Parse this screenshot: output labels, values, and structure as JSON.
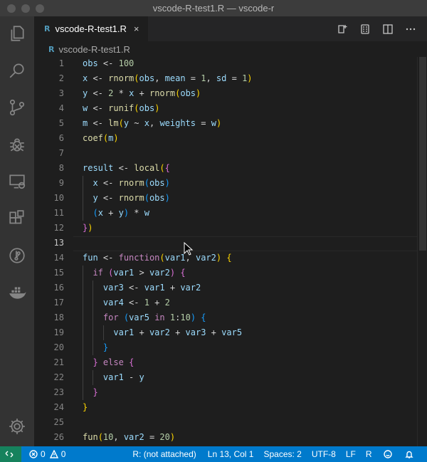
{
  "window": {
    "title": "vscode-R-test1.R — vscode-r"
  },
  "tab": {
    "label": "vscode-R-test1.R",
    "close": "×",
    "file_icon": "R"
  },
  "breadcrumb": {
    "label": "vscode-R-test1.R",
    "file_icon": "R"
  },
  "activity_bar": [
    "explorer-icon",
    "search-icon",
    "source-control-icon",
    "debug-icon",
    "remote-explorer-icon",
    "extensions-icon",
    "git-graph-icon",
    "docker-icon",
    "settings-gear-icon"
  ],
  "editor_actions": [
    "run-source-icon",
    "preview-icon",
    "split-editor-icon",
    "more-actions-icon"
  ],
  "editor": {
    "current_line": 13,
    "lines": [
      {
        "n": "1",
        "tokens": [
          [
            "obs",
            "v"
          ],
          [
            " <- ",
            "o"
          ],
          [
            "100",
            "n"
          ]
        ]
      },
      {
        "n": "2",
        "tokens": [
          [
            "x",
            "v"
          ],
          [
            " <- ",
            "o"
          ],
          [
            "rnorm",
            "f"
          ],
          [
            "(",
            "b1"
          ],
          [
            "obs",
            "v"
          ],
          [
            ", ",
            "o"
          ],
          [
            "mean",
            "v"
          ],
          [
            " = ",
            "o"
          ],
          [
            "1",
            "n"
          ],
          [
            ", ",
            "o"
          ],
          [
            "sd",
            "v"
          ],
          [
            " = ",
            "o"
          ],
          [
            "1",
            "n"
          ],
          [
            ")",
            "b1"
          ]
        ]
      },
      {
        "n": "3",
        "tokens": [
          [
            "y",
            "v"
          ],
          [
            " <- ",
            "o"
          ],
          [
            "2",
            "n"
          ],
          [
            " * ",
            "o"
          ],
          [
            "x",
            "v"
          ],
          [
            " + ",
            "o"
          ],
          [
            "rnorm",
            "f"
          ],
          [
            "(",
            "b1"
          ],
          [
            "obs",
            "v"
          ],
          [
            ")",
            "b1"
          ]
        ]
      },
      {
        "n": "4",
        "tokens": [
          [
            "w",
            "v"
          ],
          [
            " <- ",
            "o"
          ],
          [
            "runif",
            "f"
          ],
          [
            "(",
            "b1"
          ],
          [
            "obs",
            "v"
          ],
          [
            ")",
            "b1"
          ]
        ]
      },
      {
        "n": "5",
        "tokens": [
          [
            "m",
            "v"
          ],
          [
            " <- ",
            "o"
          ],
          [
            "lm",
            "f"
          ],
          [
            "(",
            "b1"
          ],
          [
            "y",
            "v"
          ],
          [
            " ~ ",
            "o"
          ],
          [
            "x",
            "v"
          ],
          [
            ", ",
            "o"
          ],
          [
            "weights",
            "v"
          ],
          [
            " = ",
            "o"
          ],
          [
            "w",
            "v"
          ],
          [
            ")",
            "b1"
          ]
        ]
      },
      {
        "n": "6",
        "tokens": [
          [
            "coef",
            "f"
          ],
          [
            "(",
            "b1"
          ],
          [
            "m",
            "v"
          ],
          [
            ")",
            "b1"
          ]
        ]
      },
      {
        "n": "7",
        "tokens": []
      },
      {
        "n": "8",
        "tokens": [
          [
            "result",
            "v"
          ],
          [
            " <- ",
            "o"
          ],
          [
            "local",
            "f"
          ],
          [
            "(",
            "b1"
          ],
          [
            "{",
            "b2"
          ]
        ]
      },
      {
        "n": "9",
        "tokens": [
          [
            "  ",
            "o"
          ],
          [
            "x",
            "v"
          ],
          [
            " <- ",
            "o"
          ],
          [
            "rnorm",
            "f"
          ],
          [
            "(",
            "b3"
          ],
          [
            "obs",
            "v"
          ],
          [
            ")",
            "b3"
          ]
        ]
      },
      {
        "n": "10",
        "tokens": [
          [
            "  ",
            "o"
          ],
          [
            "y",
            "v"
          ],
          [
            " <- ",
            "o"
          ],
          [
            "rnorm",
            "f"
          ],
          [
            "(",
            "b3"
          ],
          [
            "obs",
            "v"
          ],
          [
            ")",
            "b3"
          ]
        ]
      },
      {
        "n": "11",
        "tokens": [
          [
            "  ",
            "o"
          ],
          [
            "(",
            "b3"
          ],
          [
            "x",
            "v"
          ],
          [
            " + ",
            "o"
          ],
          [
            "y",
            "v"
          ],
          [
            ")",
            "b3"
          ],
          [
            " * ",
            "o"
          ],
          [
            "w",
            "v"
          ]
        ]
      },
      {
        "n": "12",
        "tokens": [
          [
            "}",
            "b2"
          ],
          [
            ")",
            "b1"
          ]
        ]
      },
      {
        "n": "13",
        "tokens": []
      },
      {
        "n": "14",
        "tokens": [
          [
            "fun",
            "v"
          ],
          [
            " <- ",
            "o"
          ],
          [
            "function",
            "k"
          ],
          [
            "(",
            "b1"
          ],
          [
            "var1",
            "v"
          ],
          [
            ", ",
            "o"
          ],
          [
            "var2",
            "v"
          ],
          [
            ")",
            "b1"
          ],
          [
            " ",
            "o"
          ],
          [
            "{",
            "b1"
          ]
        ]
      },
      {
        "n": "15",
        "tokens": [
          [
            "  ",
            "o"
          ],
          [
            "if",
            "k"
          ],
          [
            " ",
            "o"
          ],
          [
            "(",
            "b2"
          ],
          [
            "var1",
            "v"
          ],
          [
            " > ",
            "o"
          ],
          [
            "var2",
            "v"
          ],
          [
            ")",
            "b2"
          ],
          [
            " ",
            "o"
          ],
          [
            "{",
            "b2"
          ]
        ]
      },
      {
        "n": "16",
        "tokens": [
          [
            "    ",
            "o"
          ],
          [
            "var3",
            "v"
          ],
          [
            " <- ",
            "o"
          ],
          [
            "var1",
            "v"
          ],
          [
            " + ",
            "o"
          ],
          [
            "var2",
            "v"
          ]
        ]
      },
      {
        "n": "17",
        "tokens": [
          [
            "    ",
            "o"
          ],
          [
            "var4",
            "v"
          ],
          [
            " <- ",
            "o"
          ],
          [
            "1",
            "n"
          ],
          [
            " + ",
            "o"
          ],
          [
            "2",
            "n"
          ]
        ]
      },
      {
        "n": "18",
        "tokens": [
          [
            "    ",
            "o"
          ],
          [
            "for",
            "k"
          ],
          [
            " ",
            "o"
          ],
          [
            "(",
            "b3"
          ],
          [
            "var5",
            "v"
          ],
          [
            " ",
            "o"
          ],
          [
            "in",
            "k"
          ],
          [
            " ",
            "o"
          ],
          [
            "1",
            "n"
          ],
          [
            ":",
            "o"
          ],
          [
            "10",
            "n"
          ],
          [
            ")",
            "b3"
          ],
          [
            " ",
            "o"
          ],
          [
            "{",
            "b3"
          ]
        ]
      },
      {
        "n": "19",
        "tokens": [
          [
            "      ",
            "o"
          ],
          [
            "var1",
            "v"
          ],
          [
            " + ",
            "o"
          ],
          [
            "var2",
            "v"
          ],
          [
            " + ",
            "o"
          ],
          [
            "var3",
            "v"
          ],
          [
            " + ",
            "o"
          ],
          [
            "var5",
            "v"
          ]
        ]
      },
      {
        "n": "20",
        "tokens": [
          [
            "    ",
            "o"
          ],
          [
            "}",
            "b3"
          ]
        ]
      },
      {
        "n": "21",
        "tokens": [
          [
            "  ",
            "o"
          ],
          [
            "}",
            "b2"
          ],
          [
            " ",
            "o"
          ],
          [
            "else",
            "k"
          ],
          [
            " ",
            "o"
          ],
          [
            "{",
            "b2"
          ]
        ]
      },
      {
        "n": "22",
        "tokens": [
          [
            "    ",
            "o"
          ],
          [
            "var1",
            "v"
          ],
          [
            " - ",
            "o"
          ],
          [
            "y",
            "v"
          ]
        ]
      },
      {
        "n": "23",
        "tokens": [
          [
            "  ",
            "o"
          ],
          [
            "}",
            "b2"
          ]
        ]
      },
      {
        "n": "24",
        "tokens": [
          [
            "}",
            "b1"
          ]
        ]
      },
      {
        "n": "25",
        "tokens": []
      },
      {
        "n": "26",
        "tokens": [
          [
            "fun",
            "f"
          ],
          [
            "(",
            "b1"
          ],
          [
            "10",
            "n"
          ],
          [
            ", ",
            "o"
          ],
          [
            "var2",
            "v"
          ],
          [
            " = ",
            "o"
          ],
          [
            "20",
            "n"
          ],
          [
            ")",
            "b1"
          ]
        ]
      }
    ]
  },
  "status_bar": {
    "errors": "0",
    "warnings": "0",
    "r_session": "R: (not attached)",
    "position": "Ln 13, Col 1",
    "spaces": "Spaces: 2",
    "encoding": "UTF-8",
    "eol": "LF",
    "language": "R"
  },
  "colors": {
    "status_bar": "#007acc",
    "remote_indicator": "#16825d",
    "activity_bar": "#333333",
    "editor_bg": "#1e1e1e"
  }
}
